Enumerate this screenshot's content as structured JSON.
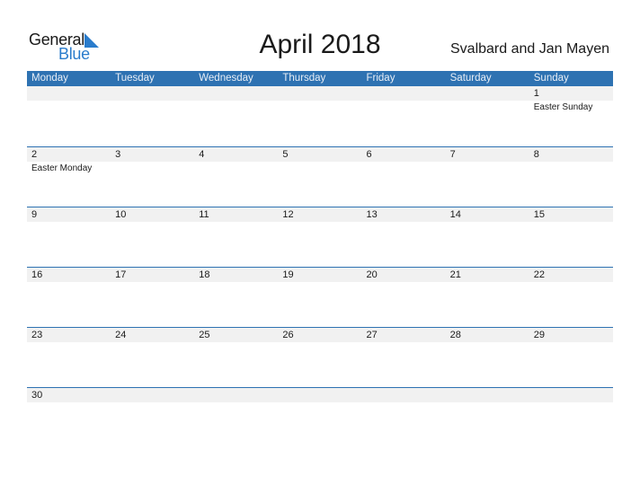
{
  "logo": {
    "word1": "General",
    "word2": "Blue",
    "brand_color": "#2a7ccc"
  },
  "title": "April 2018",
  "region": "Svalbard and Jan Mayen",
  "colors": {
    "header": "#2e72b2",
    "strip": "#f1f1f1"
  },
  "weekdays": [
    "Monday",
    "Tuesday",
    "Wednesday",
    "Thursday",
    "Friday",
    "Saturday",
    "Sunday"
  ],
  "weeks": [
    [
      {
        "d": ""
      },
      {
        "d": ""
      },
      {
        "d": ""
      },
      {
        "d": ""
      },
      {
        "d": ""
      },
      {
        "d": ""
      },
      {
        "d": "1",
        "h": "Easter Sunday"
      }
    ],
    [
      {
        "d": "2",
        "h": "Easter Monday"
      },
      {
        "d": "3"
      },
      {
        "d": "4"
      },
      {
        "d": "5"
      },
      {
        "d": "6"
      },
      {
        "d": "7"
      },
      {
        "d": "8"
      }
    ],
    [
      {
        "d": "9"
      },
      {
        "d": "10"
      },
      {
        "d": "11"
      },
      {
        "d": "12"
      },
      {
        "d": "13"
      },
      {
        "d": "14"
      },
      {
        "d": "15"
      }
    ],
    [
      {
        "d": "16"
      },
      {
        "d": "17"
      },
      {
        "d": "18"
      },
      {
        "d": "19"
      },
      {
        "d": "20"
      },
      {
        "d": "21"
      },
      {
        "d": "22"
      }
    ],
    [
      {
        "d": "23"
      },
      {
        "d": "24"
      },
      {
        "d": "25"
      },
      {
        "d": "26"
      },
      {
        "d": "27"
      },
      {
        "d": "28"
      },
      {
        "d": "29"
      }
    ],
    [
      {
        "d": "30"
      },
      {
        "d": ""
      },
      {
        "d": ""
      },
      {
        "d": ""
      },
      {
        "d": ""
      },
      {
        "d": ""
      },
      {
        "d": ""
      }
    ]
  ]
}
